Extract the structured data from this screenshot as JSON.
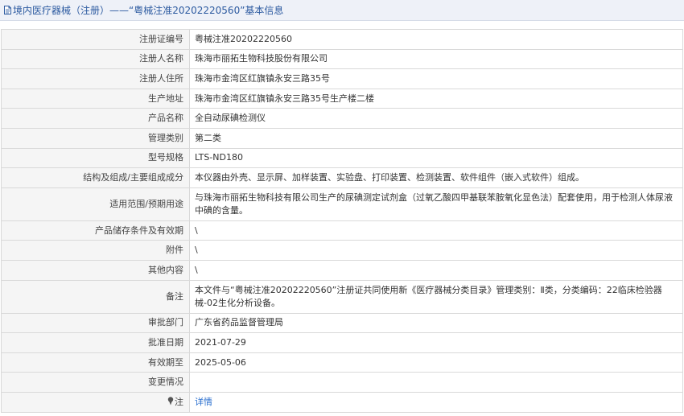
{
  "header": {
    "title": "境内医疗器械（注册）——“粤械注准20202220560”基本信息"
  },
  "rows": [
    {
      "label": "注册证编号",
      "value": "粤械注准20202220560"
    },
    {
      "label": "注册人名称",
      "value": "珠海市丽拓生物科技股份有限公司"
    },
    {
      "label": "注册人住所",
      "value": "珠海市金湾区红旗镇永安三路35号"
    },
    {
      "label": "生产地址",
      "value": "珠海市金湾区红旗镇永安三路35号生产楼二楼"
    },
    {
      "label": "产品名称",
      "value": "全自动尿碘检测仪"
    },
    {
      "label": "管理类别",
      "value": "第二类"
    },
    {
      "label": "型号规格",
      "value": "LTS-ND180"
    },
    {
      "label": "结构及组成/主要组成成分",
      "value": "本仪器由外壳、显示屏、加样装置、实验盘、打印装置、检测装置、软件组件（嵌入式软件）组成。"
    },
    {
      "label": "适用范围/预期用途",
      "value": "与珠海市丽拓生物科技有限公司生产的尿碘测定试剂盒（过氧乙酸四甲基联苯胺氧化显色法）配套使用，用于检测人体尿液中碘的含量。"
    },
    {
      "label": "产品储存条件及有效期",
      "value": "\\"
    },
    {
      "label": "附件",
      "value": "\\"
    },
    {
      "label": "其他内容",
      "value": "\\"
    },
    {
      "label": "备注",
      "value": "本文件与“粤械注准20202220560”注册证共同使用新《医疗器械分类目录》管理类别：Ⅱ类，分类编码：22临床检验器械-02生化分析设备。"
    },
    {
      "label": "审批部门",
      "value": "广东省药品监督管理局"
    },
    {
      "label": "批准日期",
      "value": "2021-07-29"
    },
    {
      "label": "有效期至",
      "value": "2025-05-06"
    },
    {
      "label": "变更情况",
      "value": ""
    },
    {
      "label": "注",
      "value": "详情"
    }
  ],
  "colors": {
    "title_text": "#2c5aa0",
    "title_bg": "#eef1f8",
    "label_bg": "#f5f5f5",
    "border": "#d9d9d9",
    "link": "#2a6fcf"
  },
  "icons": {
    "title": "document-icon",
    "note": "pin-icon"
  }
}
